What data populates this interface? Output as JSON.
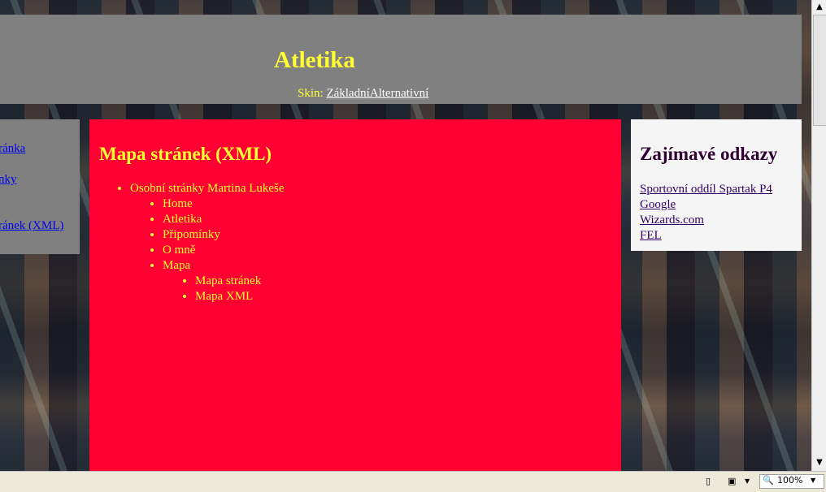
{
  "header": {
    "title": "Atletika",
    "skin_label": "Skin:",
    "skin_options": [
      "Základní",
      "Alternativní"
    ]
  },
  "left_nav": {
    "items": [
      "ránka",
      "nky",
      "ránek (XML)"
    ]
  },
  "main": {
    "title": "Mapa stránek (XML)",
    "sitemap": {
      "root": "Osobní stránky Martina Lukeše",
      "children": [
        "Home",
        "Atletika",
        "Připomínky",
        "O mně",
        "Mapa"
      ],
      "mapa_children": [
        "Mapa stránek",
        "Mapa XML"
      ]
    }
  },
  "sidebar": {
    "title": "Zajímavé odkazy",
    "links": [
      "Sportovní oddíl Spartak P4",
      "Google",
      "Wizards.com",
      "FEL"
    ]
  },
  "statusbar": {
    "zoom": "100%",
    "icons": [
      "page-icon",
      "security-icon",
      "zoom-icon"
    ]
  },
  "colors": {
    "header_bg": "#808080",
    "title_yellow": "#ffff33",
    "main_bg": "#ff0033",
    "sidebar_bg": "#f5f5f5"
  }
}
